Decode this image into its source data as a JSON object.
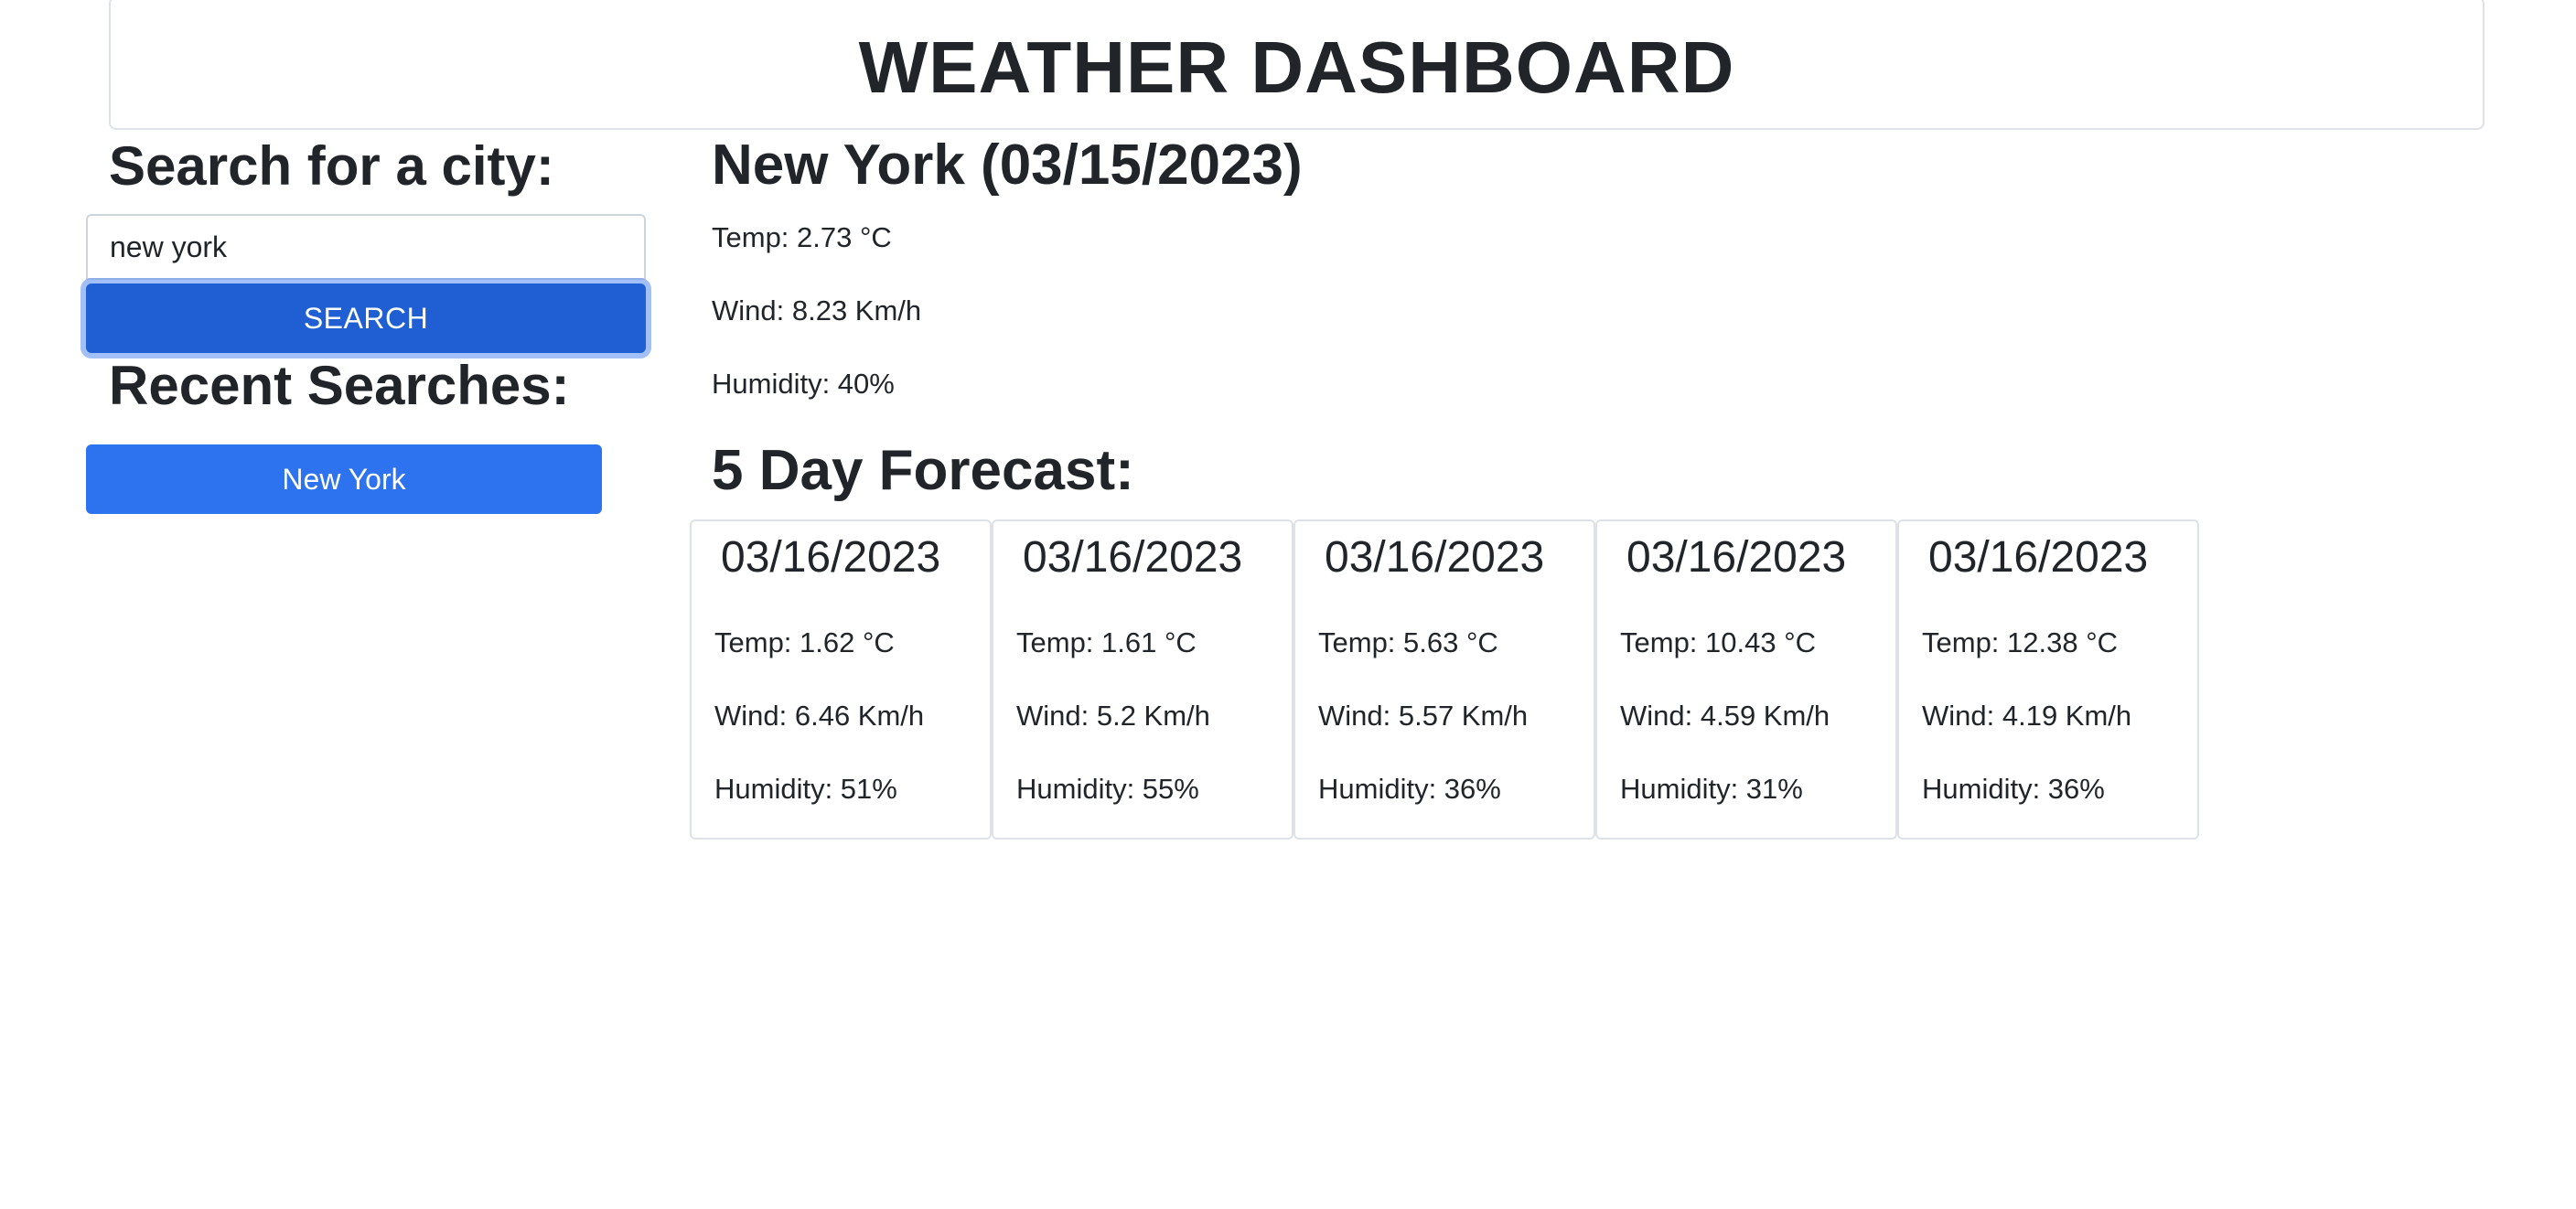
{
  "header": {
    "title": "WEATHER DASHBOARD"
  },
  "sidebar": {
    "search_heading": "Search for a city:",
    "search_input": {
      "value": "new york",
      "placeholder": ""
    },
    "search_button_label": "SEARCH",
    "recent_heading": "Recent Searches:",
    "recent_searches": [
      "New York"
    ]
  },
  "current": {
    "title": "New York (03/15/2023)",
    "temp": "Temp: 2.73 °C",
    "wind": "Wind: 8.23 Km/h",
    "humidity": "Humidity: 40%"
  },
  "forecast": {
    "title": "5 Day Forecast:",
    "days": [
      {
        "date": "03/16/2023",
        "temp": "Temp: 1.62 °C",
        "wind": "Wind: 6.46 Km/h",
        "humidity": "Humidity: 51%"
      },
      {
        "date": "03/16/2023",
        "temp": "Temp: 1.61 °C",
        "wind": "Wind: 5.2 Km/h",
        "humidity": "Humidity: 55%"
      },
      {
        "date": "03/16/2023",
        "temp": "Temp: 5.63 °C",
        "wind": "Wind: 5.57 Km/h",
        "humidity": "Humidity: 36%"
      },
      {
        "date": "03/16/2023",
        "temp": "Temp: 10.43 °C",
        "wind": "Wind: 4.59 Km/h",
        "humidity": "Humidity: 31%"
      },
      {
        "date": "03/16/2023",
        "temp": "Temp: 12.38 °C",
        "wind": "Wind: 4.19 Km/h",
        "humidity": "Humidity: 36%"
      }
    ]
  },
  "colors": {
    "search_button": "#1f5fd3",
    "recent_button": "#2d73f0",
    "text": "#212529",
    "border": "#dee2e6"
  }
}
